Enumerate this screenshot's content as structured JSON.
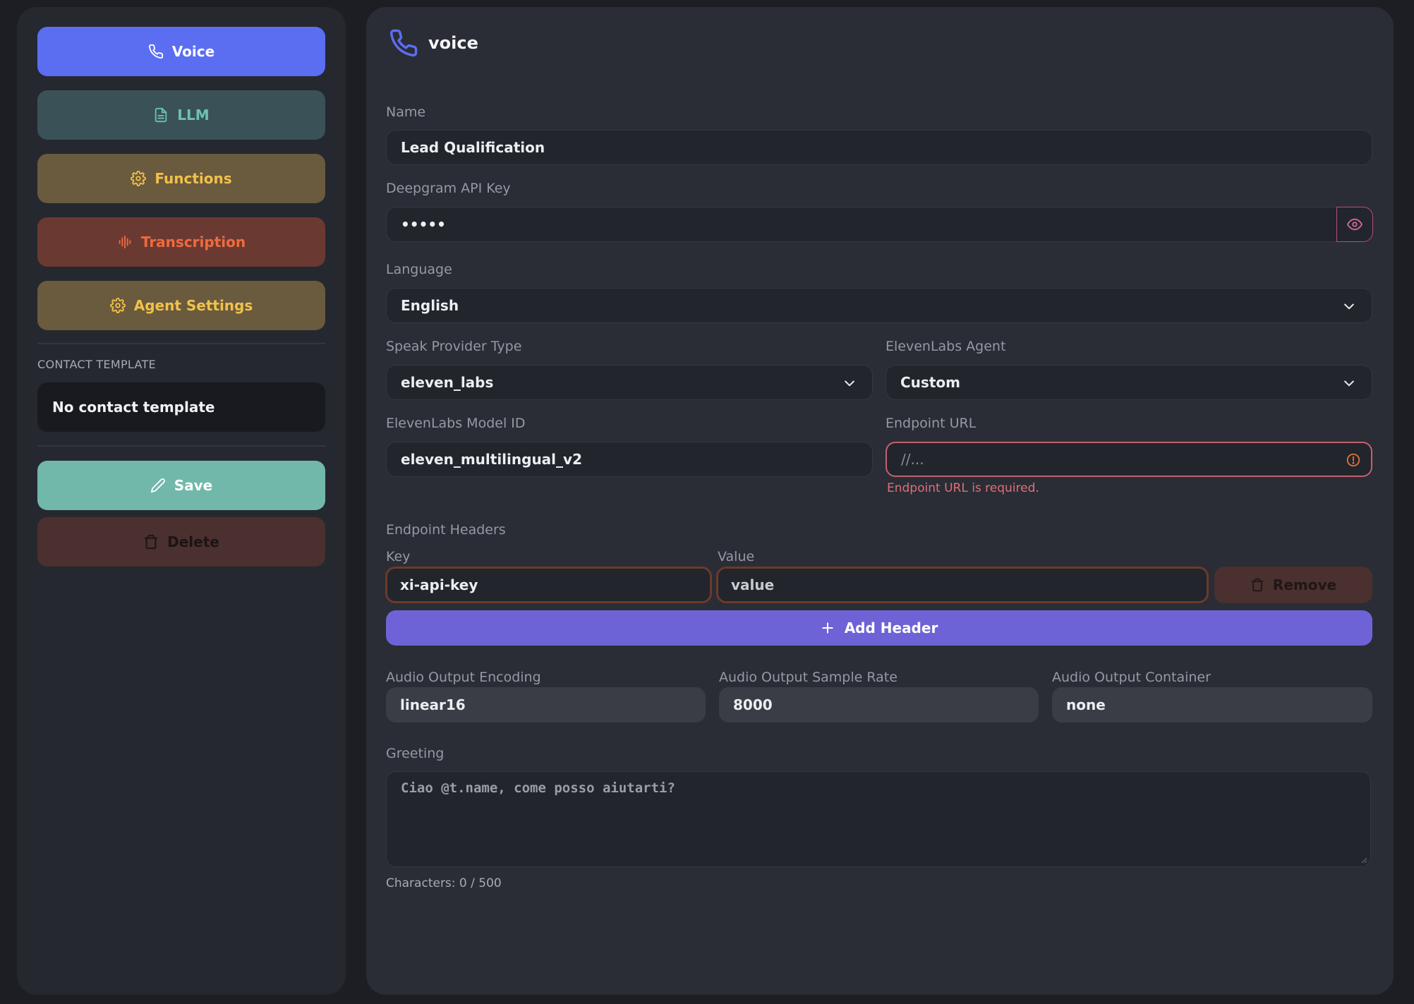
{
  "sidebar": {
    "nav": [
      {
        "label": "Voice",
        "icon": "phone-icon"
      },
      {
        "label": "LLM",
        "icon": "document-icon"
      },
      {
        "label": "Functions",
        "icon": "gear-icon"
      },
      {
        "label": "Transcription",
        "icon": "waveform-icon"
      },
      {
        "label": "Agent Settings",
        "icon": "gear-icon"
      }
    ],
    "contact_template_label": "CONTACT TEMPLATE",
    "contact_template_value": "No contact template",
    "save_label": "Save",
    "delete_label": "Delete"
  },
  "colors": {
    "voice": "#5b6ef2",
    "llm": "#3a5257",
    "functions": "#6a5a3e",
    "transcription": "#6a3a32",
    "agent_settings": "#6a5a3e",
    "save": "#72b8aa",
    "delete": "#4a302e",
    "add_header": "#6d63d6"
  },
  "header": {
    "title": "voice",
    "icon": "phone-icon"
  },
  "form": {
    "name": {
      "label": "Name",
      "value": "Lead Qualification"
    },
    "deepgram": {
      "label": "Deepgram API Key",
      "value": "•••••"
    },
    "language": {
      "label": "Language",
      "value": "English"
    },
    "speak_provider": {
      "label": "Speak Provider Type",
      "value": "eleven_labs"
    },
    "elevenlabs_agent": {
      "label": "ElevenLabs Agent",
      "value": "Custom"
    },
    "model_id": {
      "label": "ElevenLabs Model ID",
      "value": "eleven_multilingual_v2"
    },
    "endpoint_url": {
      "label": "Endpoint URL",
      "placeholder": "//...",
      "error": "Endpoint URL is required."
    },
    "endpoint_headers": {
      "label": "Endpoint Headers",
      "key_label": "Key",
      "value_label": "Value",
      "rows": [
        {
          "key": "xi-api-key",
          "value": "value"
        }
      ],
      "remove_label": "Remove",
      "add_label": "Add Header"
    },
    "audio_encoding": {
      "label": "Audio Output Encoding",
      "value": "linear16"
    },
    "audio_sample_rate": {
      "label": "Audio Output Sample Rate",
      "value": "8000"
    },
    "audio_container": {
      "label": "Audio Output Container",
      "value": "none"
    },
    "greeting": {
      "label": "Greeting",
      "placeholder": "Ciao @t.name, come posso aiutarti?",
      "char_count": "Characters: 0 / 500"
    }
  }
}
